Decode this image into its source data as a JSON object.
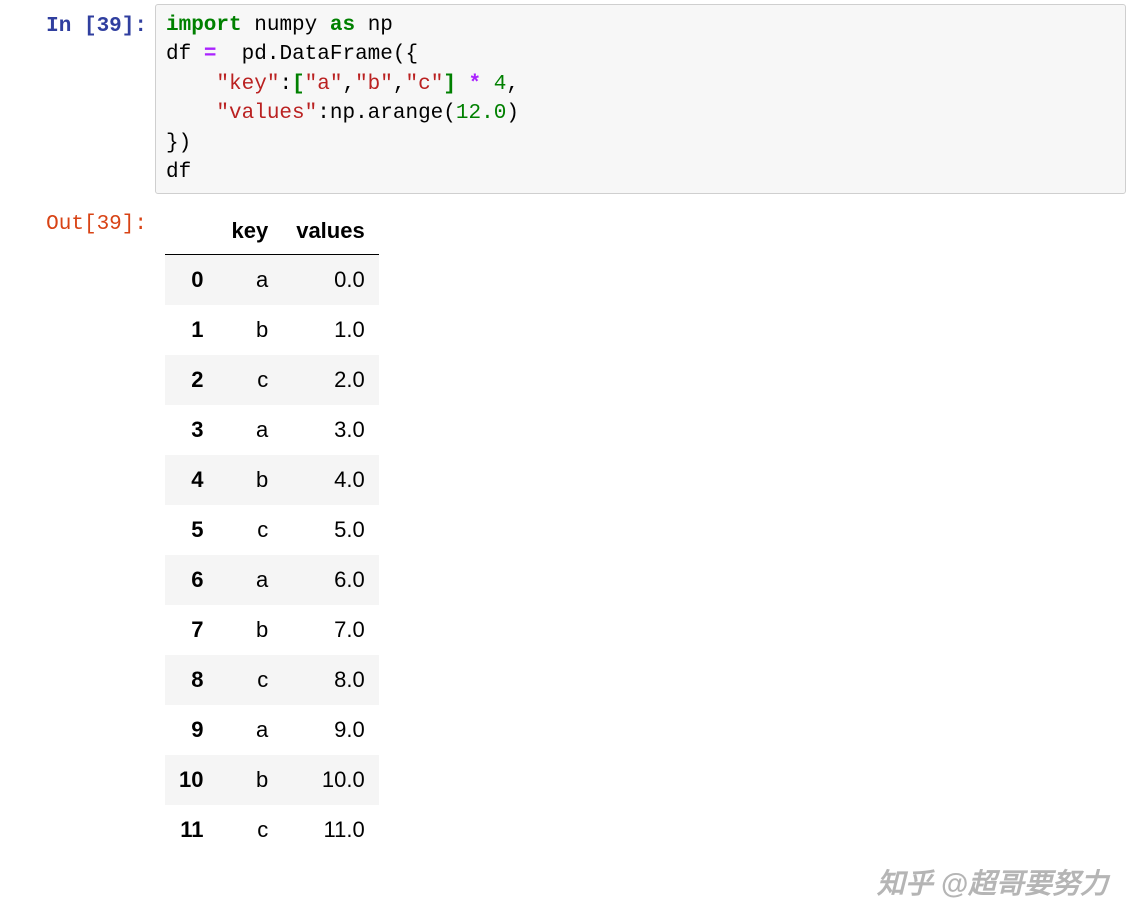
{
  "input": {
    "prompt_label": "In [39]:",
    "code": {
      "kw_import": "import",
      "mod_numpy": "numpy",
      "kw_as": "as",
      "alias_np": "np",
      "lhs_df": "df",
      "eq": "=",
      "pd_dataframe": "pd.DataFrame({",
      "key_str": "\"key\"",
      "colon1": ":",
      "lbracket": "[",
      "a": "\"a\"",
      "comma1": ",",
      "b": "\"b\"",
      "comma2": ",",
      "c": "\"c\"",
      "rbracket": "]",
      "star": "*",
      "four": "4",
      "comma3": ",",
      "values_str": "\"values\"",
      "colon2": ":",
      "np_arange_open": "np.arange(",
      "twelve": "12.0",
      "close_paren": ")",
      "close_brace": "})",
      "df_last": "df"
    }
  },
  "output": {
    "prompt_label": "Out[39]:",
    "columns": [
      "key",
      "values"
    ],
    "rows": [
      {
        "index": "0",
        "key": "a",
        "values": "0.0"
      },
      {
        "index": "1",
        "key": "b",
        "values": "1.0"
      },
      {
        "index": "2",
        "key": "c",
        "values": "2.0"
      },
      {
        "index": "3",
        "key": "a",
        "values": "3.0"
      },
      {
        "index": "4",
        "key": "b",
        "values": "4.0"
      },
      {
        "index": "5",
        "key": "c",
        "values": "5.0"
      },
      {
        "index": "6",
        "key": "a",
        "values": "6.0"
      },
      {
        "index": "7",
        "key": "b",
        "values": "7.0"
      },
      {
        "index": "8",
        "key": "c",
        "values": "8.0"
      },
      {
        "index": "9",
        "key": "a",
        "values": "9.0"
      },
      {
        "index": "10",
        "key": "b",
        "values": "10.0"
      },
      {
        "index": "11",
        "key": "c",
        "values": "11.0"
      }
    ]
  },
  "watermark": "知乎 @超哥要努力"
}
